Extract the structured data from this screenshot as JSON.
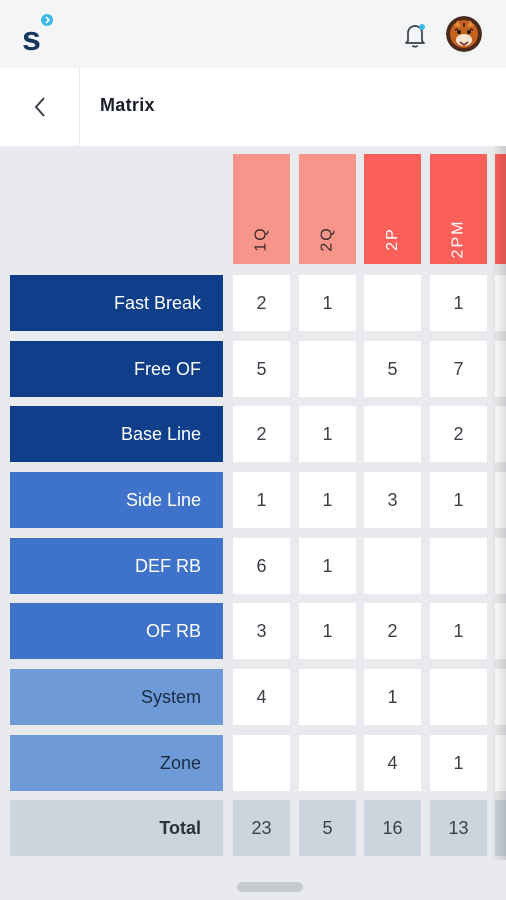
{
  "header": {
    "title": "Matrix"
  },
  "colors": {
    "header_light": "#f7958b",
    "header_dark": "#fb5f5a",
    "row_dark": "#0f3f8a",
    "row_mid": "#3f73c9",
    "row_light": "#6e9bd8",
    "total_bg": "#ccd4dd"
  },
  "columns": [
    "1Q",
    "2Q",
    "2P",
    "2PM"
  ],
  "rows": [
    {
      "label": "Fast Break",
      "values": [
        "2",
        "1",
        "",
        "1"
      ]
    },
    {
      "label": "Free OF",
      "values": [
        "5",
        "",
        "5",
        "7"
      ]
    },
    {
      "label": "Base Line",
      "values": [
        "2",
        "1",
        "",
        "2"
      ]
    },
    {
      "label": "Side Line",
      "values": [
        "1",
        "1",
        "3",
        "1"
      ]
    },
    {
      "label": "DEF RB",
      "values": [
        "6",
        "1",
        "",
        ""
      ]
    },
    {
      "label": "OF RB",
      "values": [
        "3",
        "1",
        "2",
        "1"
      ]
    },
    {
      "label": "System",
      "values": [
        "4",
        "",
        "1",
        ""
      ]
    },
    {
      "label": "Zone",
      "values": [
        "",
        "",
        "4",
        "1"
      ]
    }
  ],
  "totals": {
    "label": "Total",
    "values": [
      "23",
      "5",
      "16",
      "13"
    ]
  }
}
